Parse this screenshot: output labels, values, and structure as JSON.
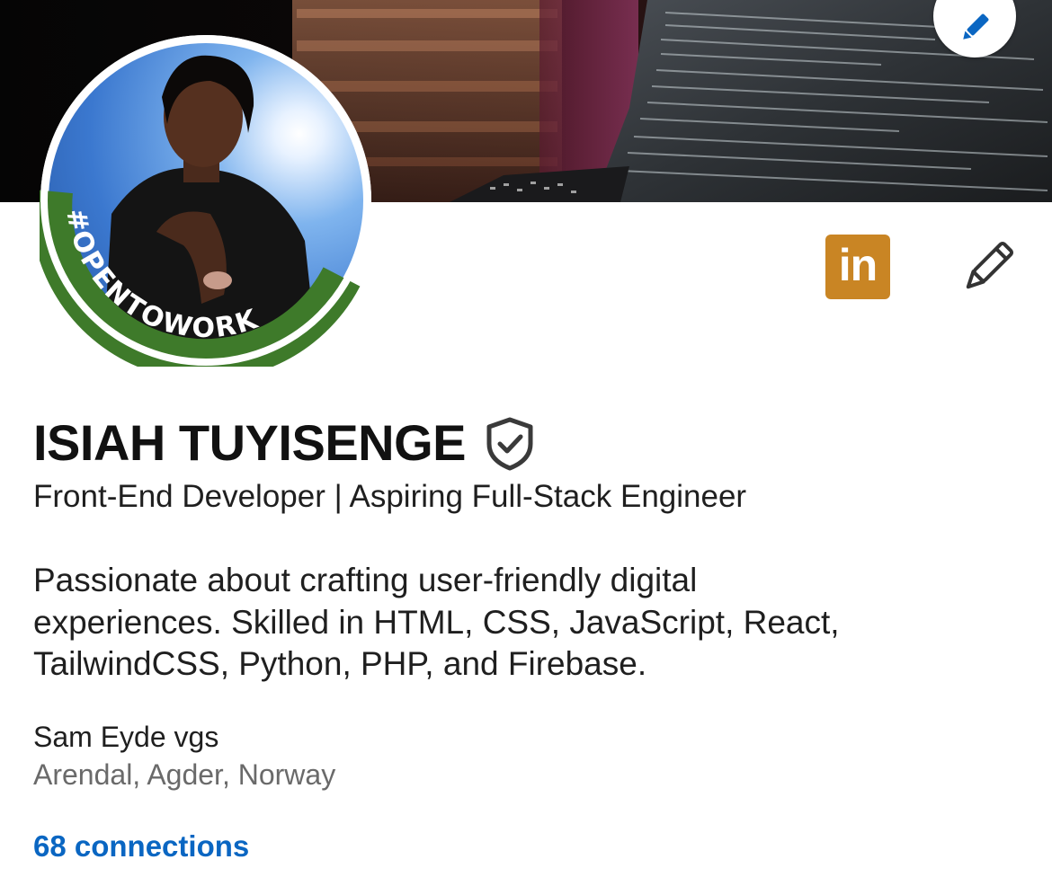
{
  "profile": {
    "name": "ISIAH TUYISENGE",
    "headline": "Front-End Developer | Aspiring Full-Stack Engineer",
    "summary_lines": [
      "Passionate about crafting user-friendly digital",
      "experiences. Skilled in HTML, CSS, JavaScript, React,",
      "TailwindCSS, Python, PHP, and Firebase."
    ],
    "school": "Sam Eyde vgs",
    "location": "Arendal, Agder, Norway",
    "connections": "68 connections",
    "open_to_work_frame": "#OPENTOWORK"
  },
  "actions": {
    "linkedin_badge_text": "in"
  },
  "icons": {
    "banner_edit": "pencil-icon",
    "profile_edit": "pencil-outline-icon",
    "verified": "shield-check-icon",
    "linkedin": "linkedin-logo-icon"
  },
  "colors": {
    "accent_blue": "#0a66c2",
    "open_to_work_green": "#3e7a2a",
    "linkedin_badge": "#c98524",
    "muted_text": "#6a6a6a"
  }
}
